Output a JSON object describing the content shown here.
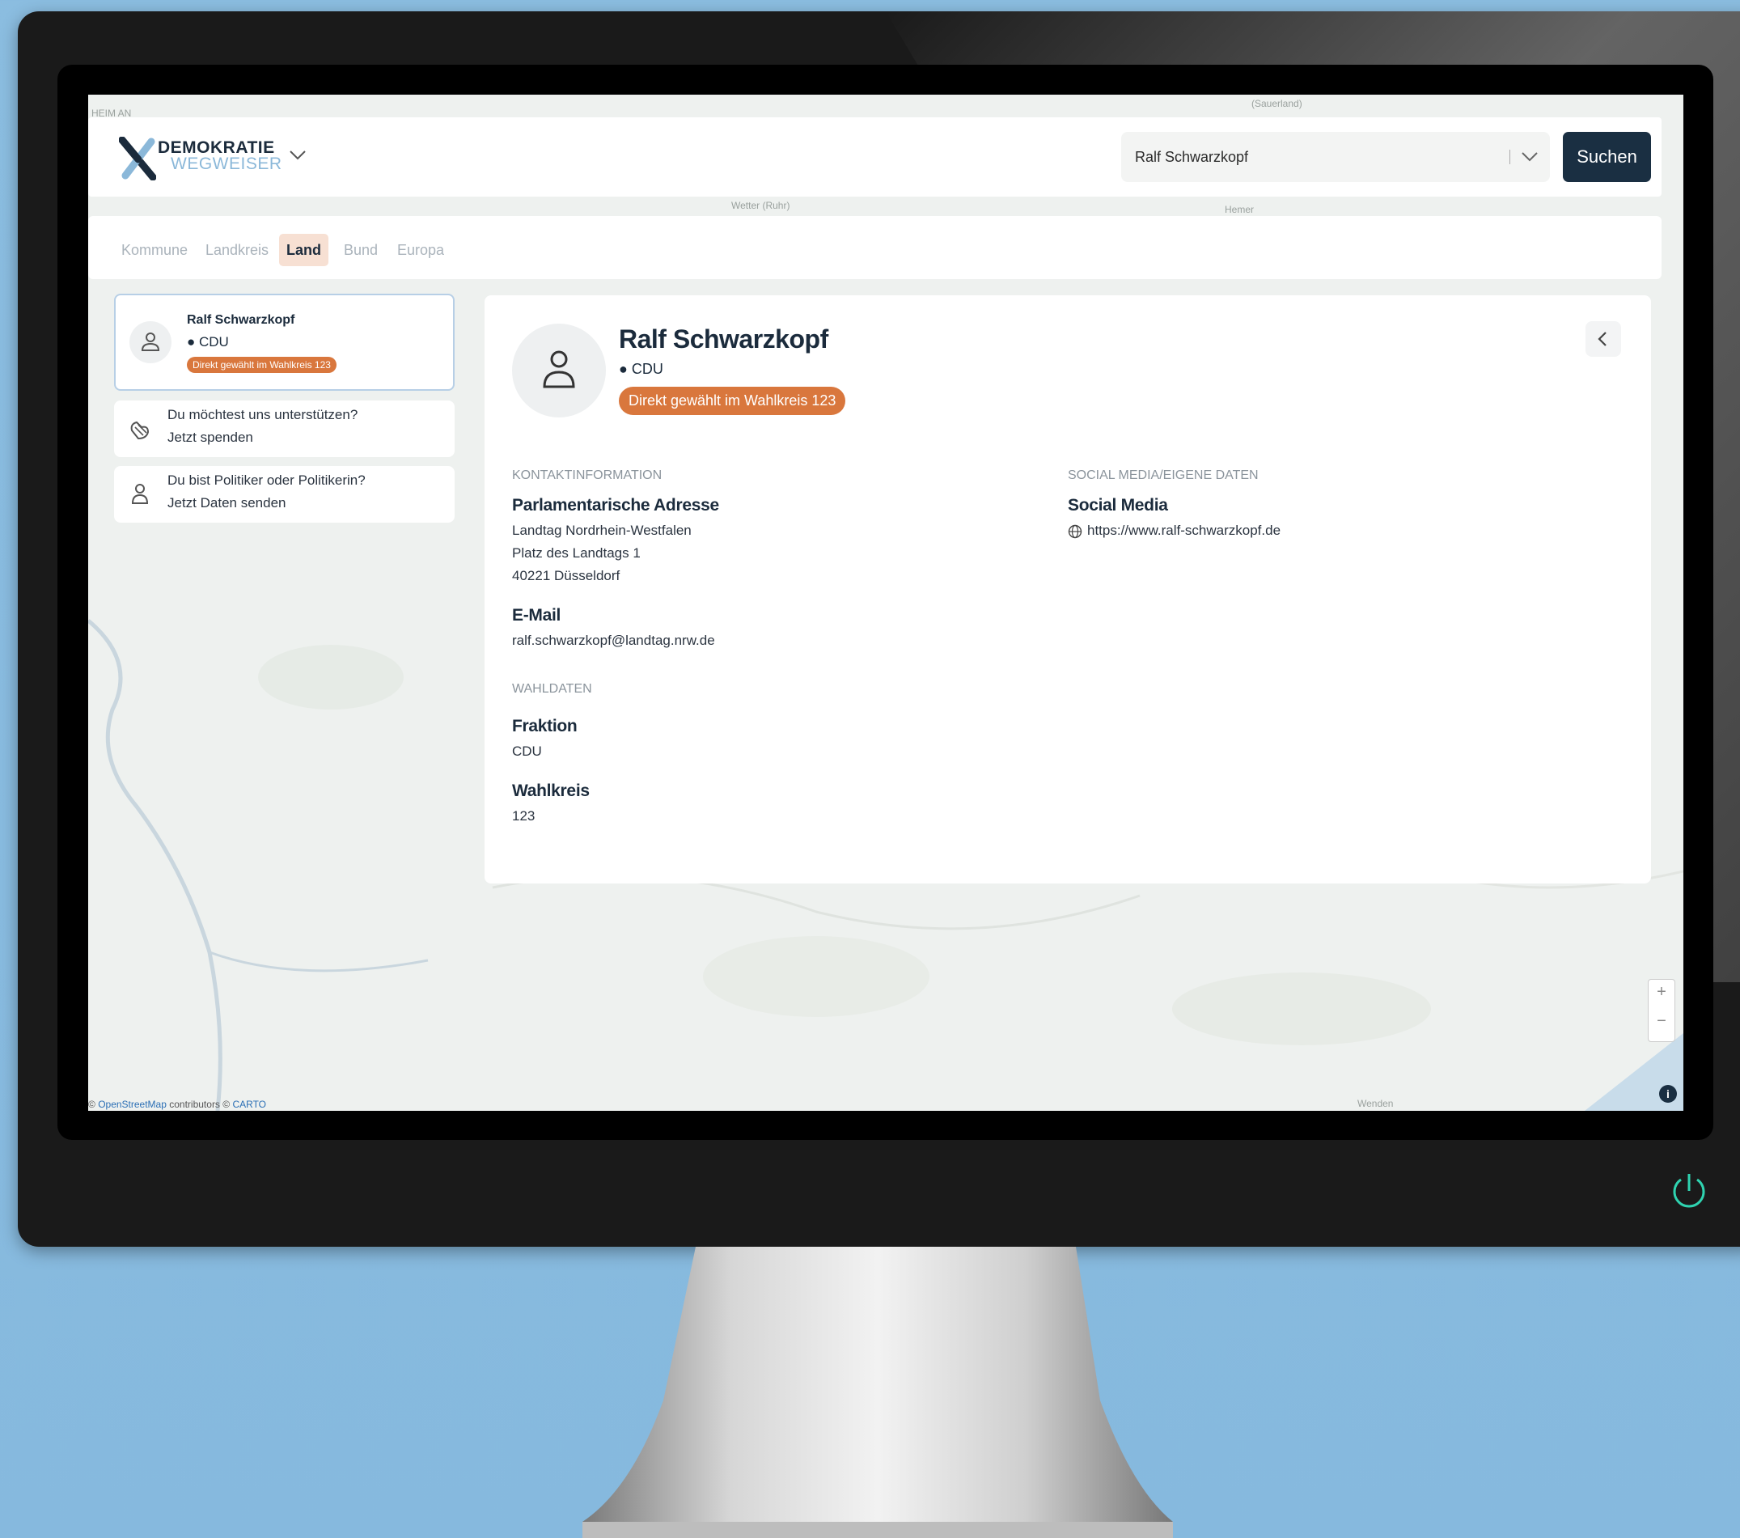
{
  "header": {
    "brand_line1": "DEMOKRATIE",
    "brand_line2": "WEGWEISER",
    "search_value": "Ralf Schwarzkopf",
    "search_button": "Suchen"
  },
  "tabs": [
    {
      "label": "Kommune",
      "active": false
    },
    {
      "label": "Landkreis",
      "active": false
    },
    {
      "label": "Land",
      "active": true
    },
    {
      "label": "Bund",
      "active": false
    },
    {
      "label": "Europa",
      "active": false
    }
  ],
  "sidebar": {
    "result": {
      "name": "Ralf Schwarzkopf",
      "party": "CDU",
      "badge": "Direkt gewählt im Wahlkreis 123"
    },
    "donate": {
      "line1": "Du möchtest uns unterstützen?",
      "line2": "Jetzt spenden"
    },
    "politician": {
      "line1": "Du bist Politiker oder Politikerin?",
      "line2": "Jetzt Daten senden"
    }
  },
  "detail": {
    "name": "Ralf Schwarzkopf",
    "party": "CDU",
    "badge": "Direkt gewählt im Wahlkreis 123",
    "contact_label": "KONTAKTINFORMATION",
    "address_title": "Parlamentarische Adresse",
    "address_lines": [
      "Landtag Nordrhein-Westfalen",
      "Platz des Landtags 1",
      "40221 Düsseldorf"
    ],
    "email_title": "E-Mail",
    "email": "ralf.schwarzkopf@landtag.nrw.de",
    "election_label": "WAHLDATEN",
    "fraktion_title": "Fraktion",
    "fraktion": "CDU",
    "wahlkreis_title": "Wahlkreis",
    "wahlkreis": "123",
    "social_label": "SOCIAL MEDIA/EIGENE DATEN",
    "social_title": "Social Media",
    "social_url": "https://www.ralf-schwarzkopf.de"
  },
  "map": {
    "labels": [
      "HEIM AN",
      "(Sauerland)",
      "Wetter (Ruhr)",
      "Hemer",
      "Wenden"
    ],
    "attribution_prefix": "© ",
    "attribution_osm": "OpenStreetMap",
    "attribution_mid": " contributors © ",
    "attribution_carto": "CARTO",
    "info": "i"
  },
  "colors": {
    "accent_dark": "#1a2f42",
    "badge_orange": "#d9773d",
    "active_tab_bg": "#f7e0d3",
    "power_green": "#2fd3b0"
  }
}
